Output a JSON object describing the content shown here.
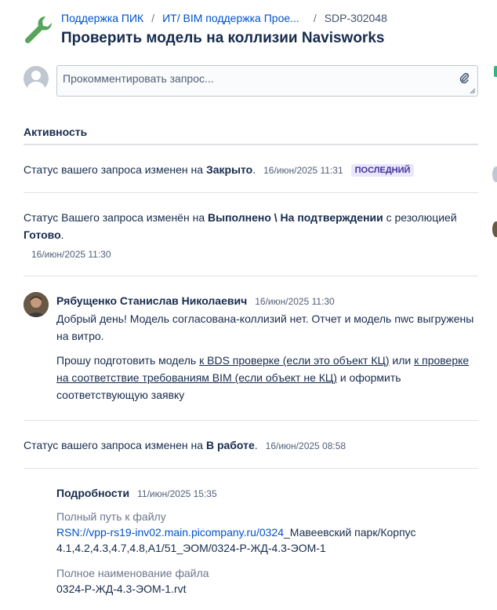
{
  "breadcrumbs": {
    "project": "Поддержка ПИК",
    "queue": "ИТ/ BIM поддержка Прое...",
    "key": "SDP-302048",
    "separator": "/"
  },
  "issue": {
    "title": "Проверить модель на коллизии Navisworks"
  },
  "comment": {
    "placeholder": "Прокомментировать запрос..."
  },
  "activity": {
    "title": "Активность",
    "items": [
      {
        "prefix": "Статус вашего запроса изменен на ",
        "status": "Закрыто",
        "suffix": ".",
        "time": "16/июн/2025 11:31",
        "badge": "ПОСЛЕДНИЙ"
      },
      {
        "prefix": "Статус Вашего запроса изменён на ",
        "status": "Выполнено \\ На подтверждении",
        "middle": " с резолюцией ",
        "resolution": "Готово",
        "suffix": ".",
        "time": "16/июн/2025 11:30"
      },
      {
        "author": "Рябущенко Станислав Николаевич",
        "time": "16/июн/2025 11:30",
        "p1": "Добрый день! Модель согласована-коллизий нет. Отчет и модель nwc выгружены на витро.",
        "p2_a": "Прошу подготовить модель ",
        "p2_link1": "к BDS проверке (если это объект КЦ)",
        "p2_b": " или ",
        "p2_link2": "к проверке на соответствие требованиям BIM (если объект не КЦ)",
        "p2_c": " и оформить соответствующую заявку"
      },
      {
        "prefix": "Статус вашего запроса изменен на ",
        "status": "В работе",
        "suffix": ".",
        "time": "16/июн/2025 08:58"
      }
    ]
  },
  "details": {
    "title": "Подробности",
    "time": "11/июн/2025 15:35",
    "path_label": "Полный путь к файлу",
    "path_link": "RSN://vpp-rs19-inv02.main.picompany.ru/0324",
    "path_rest": "_Мавеевский парк/Корпус 4.1,4.2,4.3,4.7,4.8,А1/51_ЭОМ/0324-Р-ЖД-4.3-ЭОМ-1",
    "file_label": "Полное наименование файла",
    "file_value": "0324-Р-ЖД-4.3-ЭОМ-1.rvt"
  },
  "colors": {
    "link": "#0052cc",
    "text": "#172b4d",
    "lozenge_bg": "#eae6ff",
    "lozenge_fg": "#403294",
    "wrench": "#57a55a"
  }
}
